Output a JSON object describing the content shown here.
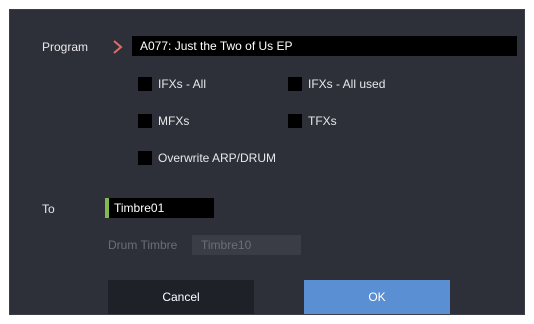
{
  "dialog": {
    "program": {
      "label": "Program",
      "value": "A077: Just the Two of Us EP"
    },
    "options": {
      "ifxs_all": "IFXs - All",
      "ifxs_all_used": "IFXs - All used",
      "mfxs": "MFXs",
      "tfxs": "TFXs",
      "overwrite_arp_drum": "Overwrite ARP/DRUM"
    },
    "to": {
      "label": "To",
      "value": "Timbre01"
    },
    "drum_timbre": {
      "label": "Drum Timbre",
      "value": "Timbre10"
    },
    "buttons": {
      "cancel": "Cancel",
      "ok": "OK"
    }
  },
  "colors": {
    "dialog_bg": "#2e3039",
    "field_bg": "#000000",
    "accent_chevron": "#e06b6b",
    "accent_green": "#86b94c",
    "ok_button": "#5b8fd3",
    "cancel_button": "#1f2129"
  },
  "icons": {
    "program_select": "chevron-right-icon"
  }
}
